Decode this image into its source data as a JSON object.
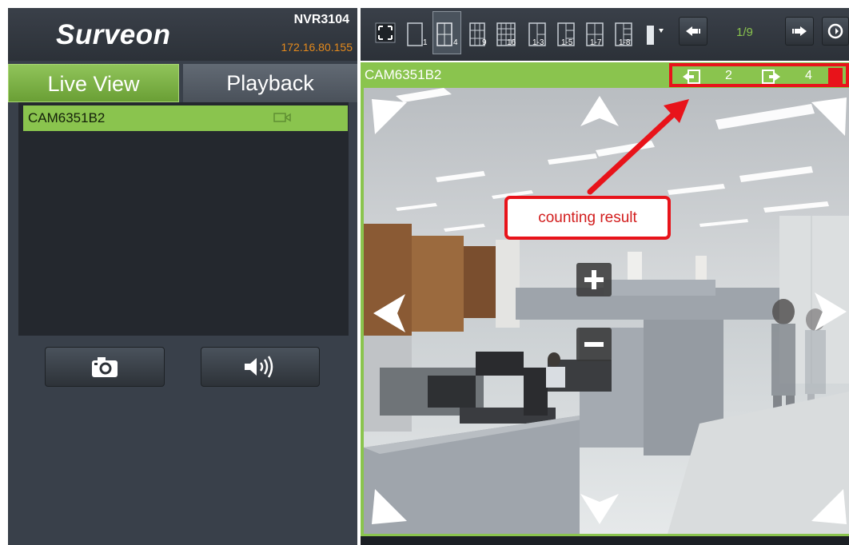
{
  "brand": {
    "logo": "Surveon",
    "model": "NVR3104",
    "ip": "172.16.80.155"
  },
  "tabs": {
    "live": "Live View",
    "playback": "Playback"
  },
  "camera_list": {
    "items": [
      {
        "name": "CAM6351B2"
      }
    ]
  },
  "toolbar": {
    "layouts": [
      "1",
      "4",
      "9",
      "16",
      "1-3",
      "1-5",
      "1-7",
      "1-8"
    ],
    "page": "1/9"
  },
  "video": {
    "title": "CAM6351B2",
    "count_in": "2",
    "count_out": "4"
  },
  "annotation": {
    "callout": "counting result"
  },
  "colors": {
    "accent": "#8ac44e",
    "highlight": "#e8131a",
    "ip": "#e58a1c"
  }
}
